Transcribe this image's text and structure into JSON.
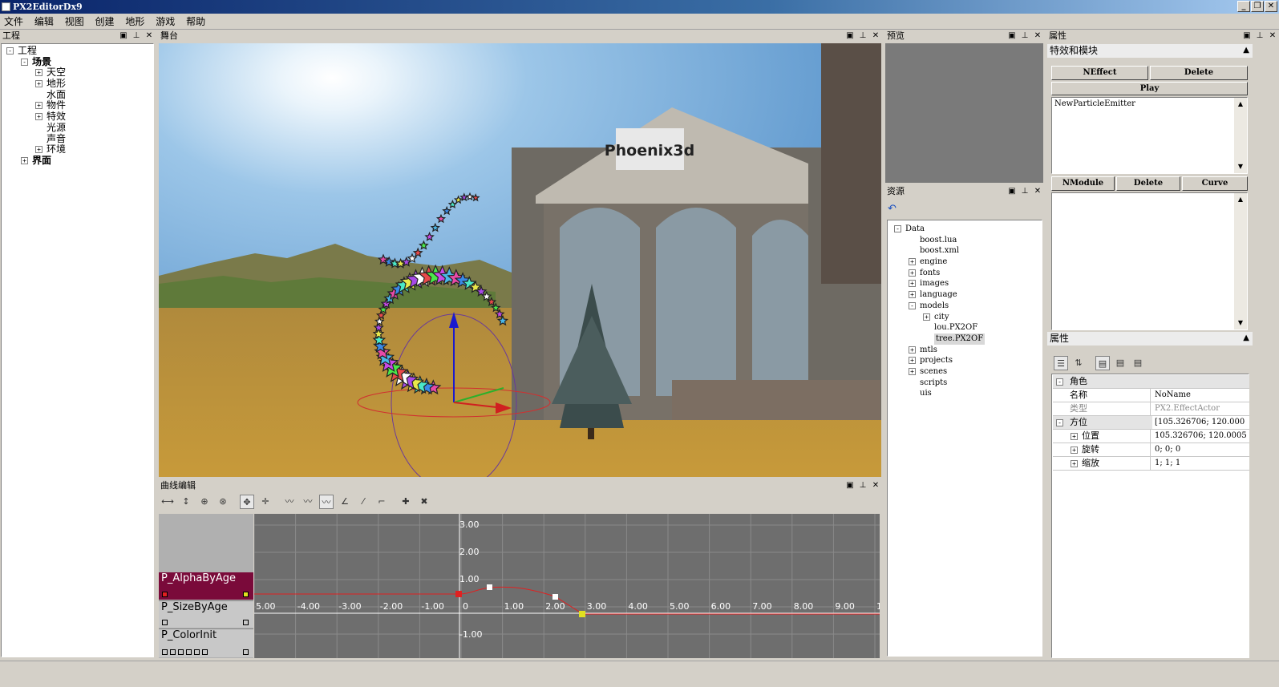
{
  "window": {
    "title": "PX2EditorDx9",
    "min": "_",
    "restore": "❐",
    "close": "✕"
  },
  "menu": [
    "文件",
    "编辑",
    "视图",
    "创建",
    "地形",
    "游戏",
    "帮助"
  ],
  "project_panel": {
    "title": "工程",
    "tree": [
      {
        "label": "工程",
        "level": 0,
        "expander": "-"
      },
      {
        "label": "场景",
        "level": 1,
        "expander": "-",
        "bold": true
      },
      {
        "label": "天空",
        "level": 2,
        "expander": "+"
      },
      {
        "label": "地形",
        "level": 2,
        "expander": "+"
      },
      {
        "label": "水面",
        "level": 2,
        "expander": ""
      },
      {
        "label": "物件",
        "level": 2,
        "expander": "+"
      },
      {
        "label": "特效",
        "level": 2,
        "expander": "+"
      },
      {
        "label": "光源",
        "level": 2,
        "expander": ""
      },
      {
        "label": "声音",
        "level": 2,
        "expander": ""
      },
      {
        "label": "环境",
        "level": 2,
        "expander": "+"
      },
      {
        "label": "界面",
        "level": 1,
        "expander": "+",
        "bold": true
      }
    ]
  },
  "stage_panel": {
    "title": "舞台",
    "sign_text": "Phoenix3d"
  },
  "preview_panel": {
    "title": "预览"
  },
  "resource_panel": {
    "title": "资源",
    "refresh_icon": "↶",
    "tree": [
      {
        "label": "Data",
        "level": 0,
        "expander": "-"
      },
      {
        "label": "boost.lua",
        "level": 1,
        "expander": ""
      },
      {
        "label": "boost.xml",
        "level": 1,
        "expander": ""
      },
      {
        "label": "engine",
        "level": 1,
        "expander": "+"
      },
      {
        "label": "fonts",
        "level": 1,
        "expander": "+"
      },
      {
        "label": "images",
        "level": 1,
        "expander": "+"
      },
      {
        "label": "language",
        "level": 1,
        "expander": "+"
      },
      {
        "label": "models",
        "level": 1,
        "expander": "-"
      },
      {
        "label": "city",
        "level": 2,
        "expander": "+"
      },
      {
        "label": "lou.PX2OF",
        "level": 2,
        "expander": ""
      },
      {
        "label": "tree.PX2OF",
        "level": 2,
        "expander": "",
        "selected": true
      },
      {
        "label": "mtls",
        "level": 1,
        "expander": "+"
      },
      {
        "label": "projects",
        "level": 1,
        "expander": "+"
      },
      {
        "label": "scenes",
        "level": 1,
        "expander": "+"
      },
      {
        "label": "scripts",
        "level": 1,
        "expander": ""
      },
      {
        "label": "uis",
        "level": 1,
        "expander": ""
      }
    ]
  },
  "properties_panel": {
    "title": "属性",
    "effect_section": "特效和模块",
    "buttons_top": [
      "NEffect",
      "Delete"
    ],
    "play_label": "Play",
    "emitter_item": "NewParticleEmitter",
    "buttons_module": [
      "NModule",
      "Delete",
      "Curve"
    ],
    "props_section": "属性",
    "grid": [
      {
        "key": "角色",
        "value": "",
        "group": true,
        "expander": "-"
      },
      {
        "key": "名称",
        "value": "NoName"
      },
      {
        "key": "类型",
        "value": "PX2.EffectActor",
        "disabled": true
      },
      {
        "key": "方位",
        "value": "[105.326706; 120.000",
        "group": true,
        "expander": "-"
      },
      {
        "key": "位置",
        "value": "105.326706; 120.0005",
        "expander": "+"
      },
      {
        "key": "旋转",
        "value": "0; 0; 0",
        "expander": "+"
      },
      {
        "key": "缩放",
        "value": "1; 1; 1",
        "expander": "+"
      }
    ]
  },
  "curve_panel": {
    "title": "曲线编辑",
    "curves": [
      "P_AlphaByAge",
      "P_SizeByAge",
      "P_ColorInit"
    ],
    "y_ticks": [
      "3.00",
      "2.00",
      "1.00",
      "-1.00"
    ],
    "x_ticks": [
      "5.00",
      "-4.00",
      "-3.00",
      "-2.00",
      "-1.00",
      "0",
      "1.00",
      "2.00",
      "3.00",
      "4.00",
      "5.00",
      "6.00",
      "7.00",
      "8.00",
      "9.00",
      "1"
    ]
  },
  "colors": {
    "selected_curve": "#7a0a3a",
    "curve_line": "#e02020",
    "panel_bg": "#d4d0c8"
  }
}
